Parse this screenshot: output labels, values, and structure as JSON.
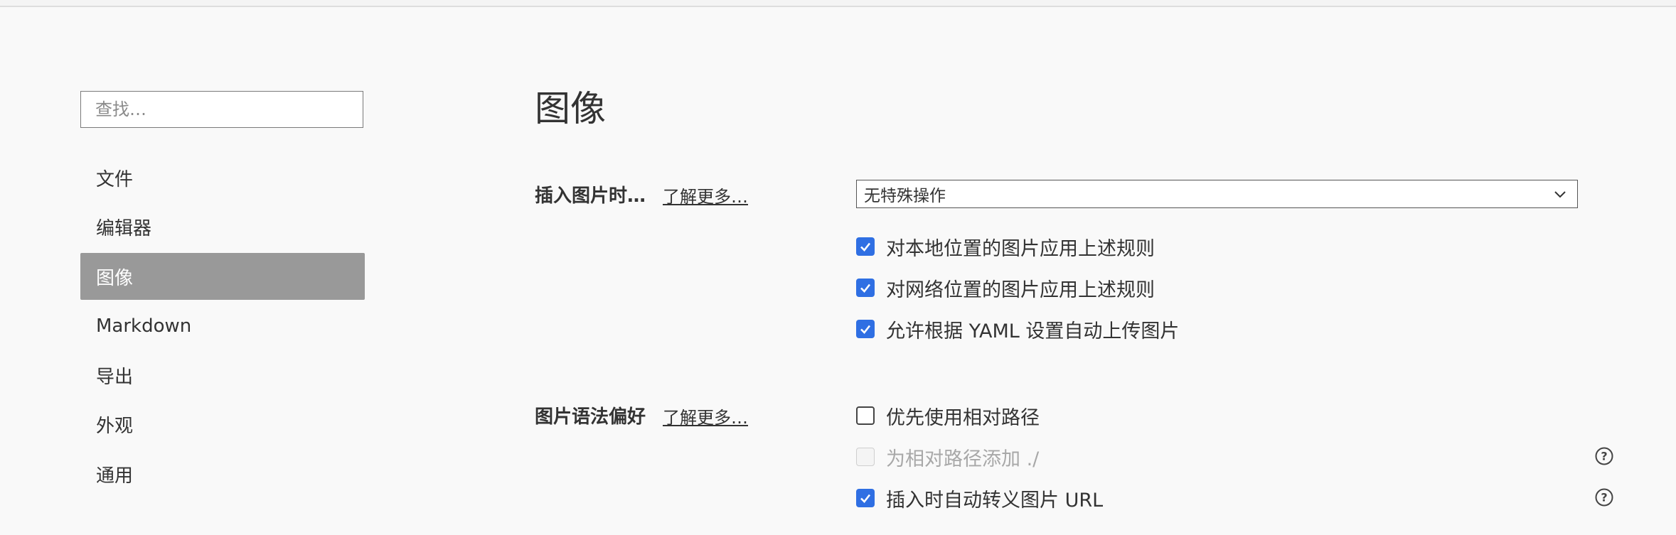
{
  "sidebar": {
    "search_placeholder": "查找…",
    "items": [
      {
        "label": "文件",
        "active": false
      },
      {
        "label": "编辑器",
        "active": false
      },
      {
        "label": "图像",
        "active": true
      },
      {
        "label": "Markdown",
        "active": false
      },
      {
        "label": "导出",
        "active": false
      },
      {
        "label": "外观",
        "active": false
      },
      {
        "label": "通用",
        "active": false
      }
    ]
  },
  "main": {
    "title": "图像",
    "insert_image": {
      "label": "插入图片时…",
      "learn_more": "了解更多…",
      "select_value": "无特殊操作",
      "options": [
        {
          "label": "对本地位置的图片应用上述规则",
          "checked": true,
          "disabled": false
        },
        {
          "label": "对网络位置的图片应用上述规则",
          "checked": true,
          "disabled": false
        },
        {
          "label": "允许根据 YAML 设置自动上传图片",
          "checked": true,
          "disabled": false
        }
      ]
    },
    "image_syntax": {
      "label": "图片语法偏好",
      "learn_more": "了解更多…",
      "options": [
        {
          "label": "优先使用相对路径",
          "checked": false,
          "disabled": false,
          "help": false
        },
        {
          "label": "为相对路径添加 ./",
          "checked": false,
          "disabled": true,
          "help": true
        },
        {
          "label": "插入时自动转义图片 URL",
          "checked": true,
          "disabled": false,
          "help": true
        }
      ]
    }
  },
  "colors": {
    "accent": "#2f6fe3",
    "sidebar_active_bg": "#999999",
    "background": "#f9f9f9"
  },
  "icons": {
    "checkmark": "checkmark-icon",
    "chevron": "chevron-down-icon",
    "help": "question-circle-icon"
  }
}
